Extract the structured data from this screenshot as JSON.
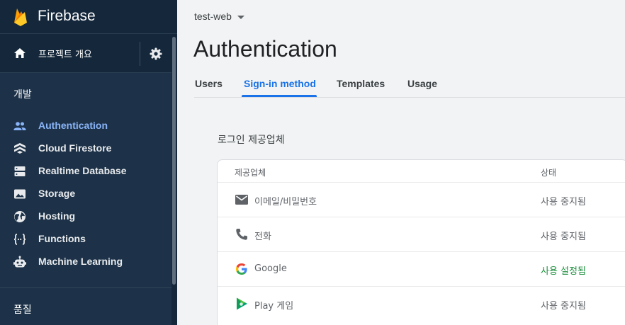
{
  "sidebar": {
    "brand": "Firebase",
    "overview_label": "프로젝트 개요",
    "section_dev": "개발",
    "section_quality": "품질",
    "items": [
      {
        "label": "Authentication",
        "icon": "people-icon"
      },
      {
        "label": "Cloud Firestore",
        "icon": "firestore-icon"
      },
      {
        "label": "Realtime Database",
        "icon": "database-icon"
      },
      {
        "label": "Storage",
        "icon": "image-icon"
      },
      {
        "label": "Hosting",
        "icon": "globe-icon"
      },
      {
        "label": "Functions",
        "icon": "functions-icon"
      },
      {
        "label": "Machine Learning",
        "icon": "robot-icon"
      }
    ]
  },
  "header": {
    "project": "test-web",
    "title": "Authentication",
    "tabs": [
      {
        "label": "Users"
      },
      {
        "label": "Sign-in method"
      },
      {
        "label": "Templates"
      },
      {
        "label": "Usage"
      }
    ]
  },
  "providers": {
    "title": "로그인 제공업체",
    "col_provider": "제공업체",
    "col_status": "상태",
    "rows": [
      {
        "name": "이메일/비밀번호",
        "status": "사용 중지됨",
        "icon": "mail-icon"
      },
      {
        "name": "전화",
        "status": "사용 중지됨",
        "icon": "phone-icon"
      },
      {
        "name": "Google",
        "status": "사용 설정됨",
        "icon": "google-icon"
      },
      {
        "name": "Play 게임",
        "status": "사용 중지됨",
        "icon": "play-games-icon"
      }
    ]
  },
  "colors": {
    "sidebar_bg": "#1d3248",
    "active_nav": "#8ab4f8",
    "tab_active": "#1a73e8",
    "status_enabled": "#1e8e3e"
  }
}
